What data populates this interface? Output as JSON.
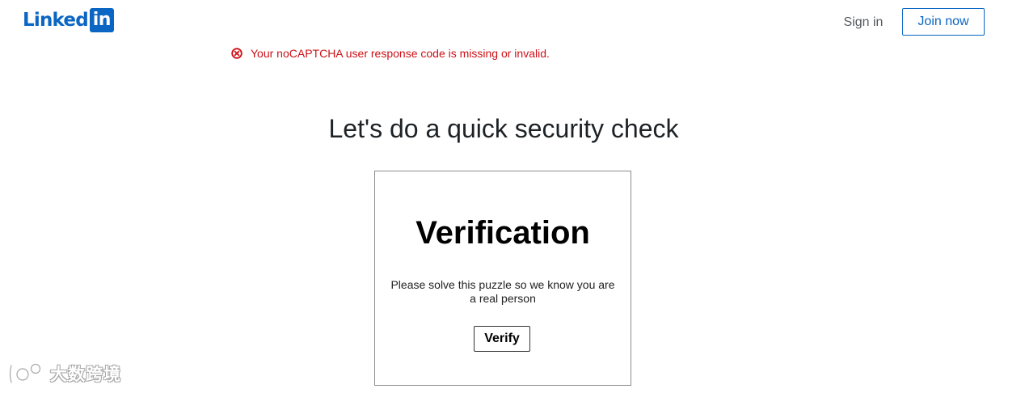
{
  "header": {
    "logo_text": "Linked",
    "logo_box_text": "in",
    "sign_in_label": "Sign in",
    "join_now_label": "Join now",
    "brand_color": "#0a66c2"
  },
  "error": {
    "icon": "error-circle-x-icon",
    "message": "Your noCAPTCHA user response code is missing or invalid.",
    "color": "#cc1016"
  },
  "main": {
    "title": "Let's do a quick security check"
  },
  "captcha": {
    "title": "Verification",
    "description": "Please solve this puzzle so we know you are a real person",
    "verify_label": "Verify"
  },
  "watermark": {
    "text": "大数跨境"
  }
}
